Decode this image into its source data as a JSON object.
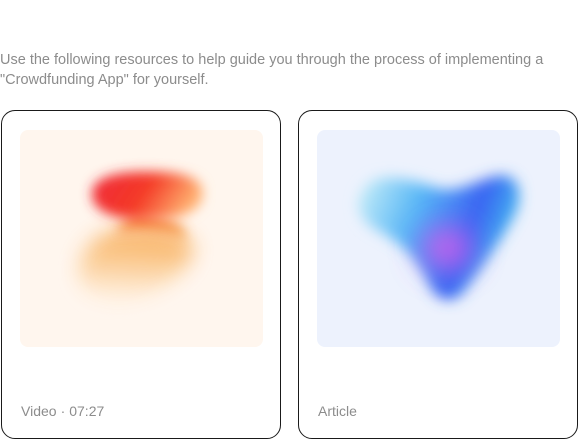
{
  "intro": {
    "line1": "Use the following resources to help guide you through the process of implementing a",
    "line2": "\"Crowdfunding App\" for yourself."
  },
  "cards": [
    {
      "type": "Video",
      "separator": "·",
      "duration": "07:27",
      "thumbnail_icon": "gradient-s-shape-icon"
    },
    {
      "type": "Article",
      "thumbnail_icon": "gradient-blob-icon"
    }
  ]
}
